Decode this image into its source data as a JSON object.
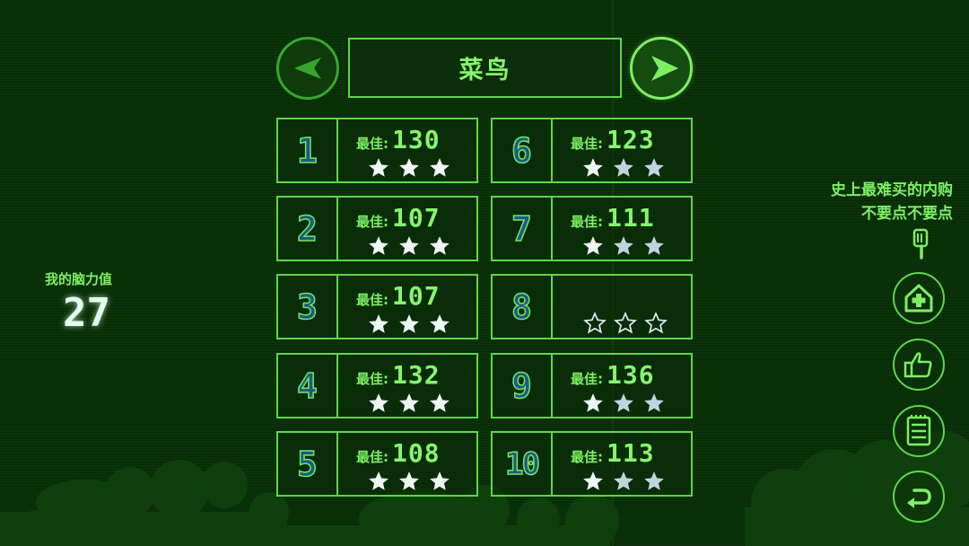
{
  "header": {
    "rank_title": "菜鸟"
  },
  "stats": {
    "brain_label": "我的脑力值",
    "brain_value": "27"
  },
  "promo": {
    "line1": "史上最难买的内购",
    "line2": "不要点不要点"
  },
  "levels": [
    {
      "number": "1",
      "best_label": "最佳:",
      "best_score": "130",
      "stars": 3
    },
    {
      "number": "2",
      "best_label": "最佳:",
      "best_score": "107",
      "stars": 3
    },
    {
      "number": "3",
      "best_label": "最佳:",
      "best_score": "107",
      "stars": 3
    },
    {
      "number": "4",
      "best_label": "最佳:",
      "best_score": "132",
      "stars": 3
    },
    {
      "number": "5",
      "best_label": "最佳:",
      "best_score": "108",
      "stars": 3
    },
    {
      "number": "6",
      "best_label": "最佳:",
      "best_score": "123",
      "stars": 3
    },
    {
      "number": "7",
      "best_label": "最佳:",
      "best_score": "111",
      "stars": 3
    },
    {
      "number": "8",
      "best_label": "",
      "best_score": "",
      "stars": 0
    },
    {
      "number": "9",
      "best_label": "最佳:",
      "best_score": "136",
      "stars": 3
    },
    {
      "number": "10",
      "best_label": "最佳:",
      "best_score": "113",
      "stars": 3
    }
  ],
  "icons": {
    "prev": "left-arrow-icon",
    "next": "right-arrow-icon",
    "star_filled": "star-icon",
    "star_empty": "star-outline-icon",
    "pointer": "pointing-hand-icon",
    "home_plus": "home-plus-icon",
    "like": "thumbs-up-icon",
    "notes": "notepad-icon",
    "back": "return-icon"
  },
  "colors": {
    "background": "#0b3209",
    "accent": "#7cf062",
    "border": "#5ed64a",
    "star_filled": "#eef7f3",
    "star_dim": "#c2d3e0",
    "level_number_fill": "#1c5a86"
  }
}
